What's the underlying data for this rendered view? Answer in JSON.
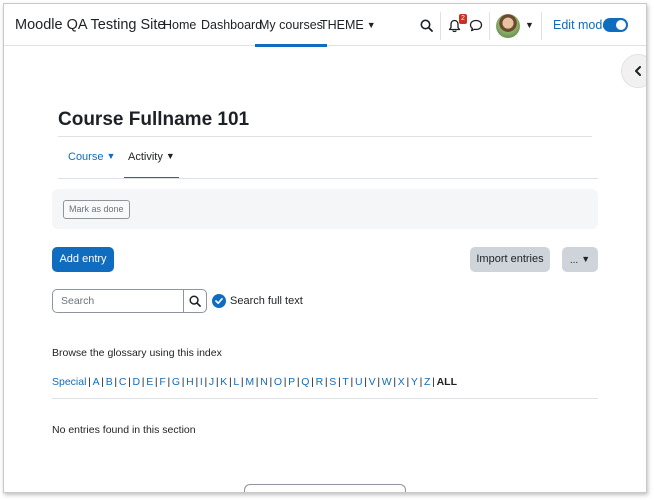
{
  "navbar": {
    "site_name": "Moodle QA Testing Site",
    "links": [
      {
        "label": "Home"
      },
      {
        "label": "Dashboard"
      },
      {
        "label": "My courses"
      },
      {
        "label": "THEME"
      }
    ],
    "notification_count": "2",
    "edit_mode_label": "Edit mode",
    "edit_mode_on": true
  },
  "page": {
    "title": "Course Fullname 101",
    "secondary_nav": [
      {
        "label": "Course"
      },
      {
        "label": "Activity"
      }
    ],
    "mark_done_label": "Mark as done",
    "add_entry_label": "Add entry",
    "import_entries_label": "Import entries",
    "more_label": "...",
    "search_placeholder": "Search",
    "search_full_text_label": "Search full text",
    "browse_text": "Browse the glossary using this index",
    "index_letters": [
      "Special",
      "A",
      "B",
      "C",
      "D",
      "E",
      "F",
      "G",
      "H",
      "I",
      "J",
      "K",
      "L",
      "M",
      "N",
      "O",
      "P",
      "Q",
      "R",
      "S",
      "T",
      "U",
      "V",
      "W",
      "X",
      "Y",
      "Z"
    ],
    "index_all": "ALL",
    "no_entries_text": "No entries found in this section"
  },
  "colors": {
    "brand": "#0f6cbf",
    "badge": "#ca3120",
    "secondary_button": "#ced4da"
  },
  "icons": [
    "search-icon",
    "bell-icon",
    "chat-icon",
    "avatar",
    "chevron-down-icon",
    "chevron-left-icon",
    "check-icon"
  ]
}
